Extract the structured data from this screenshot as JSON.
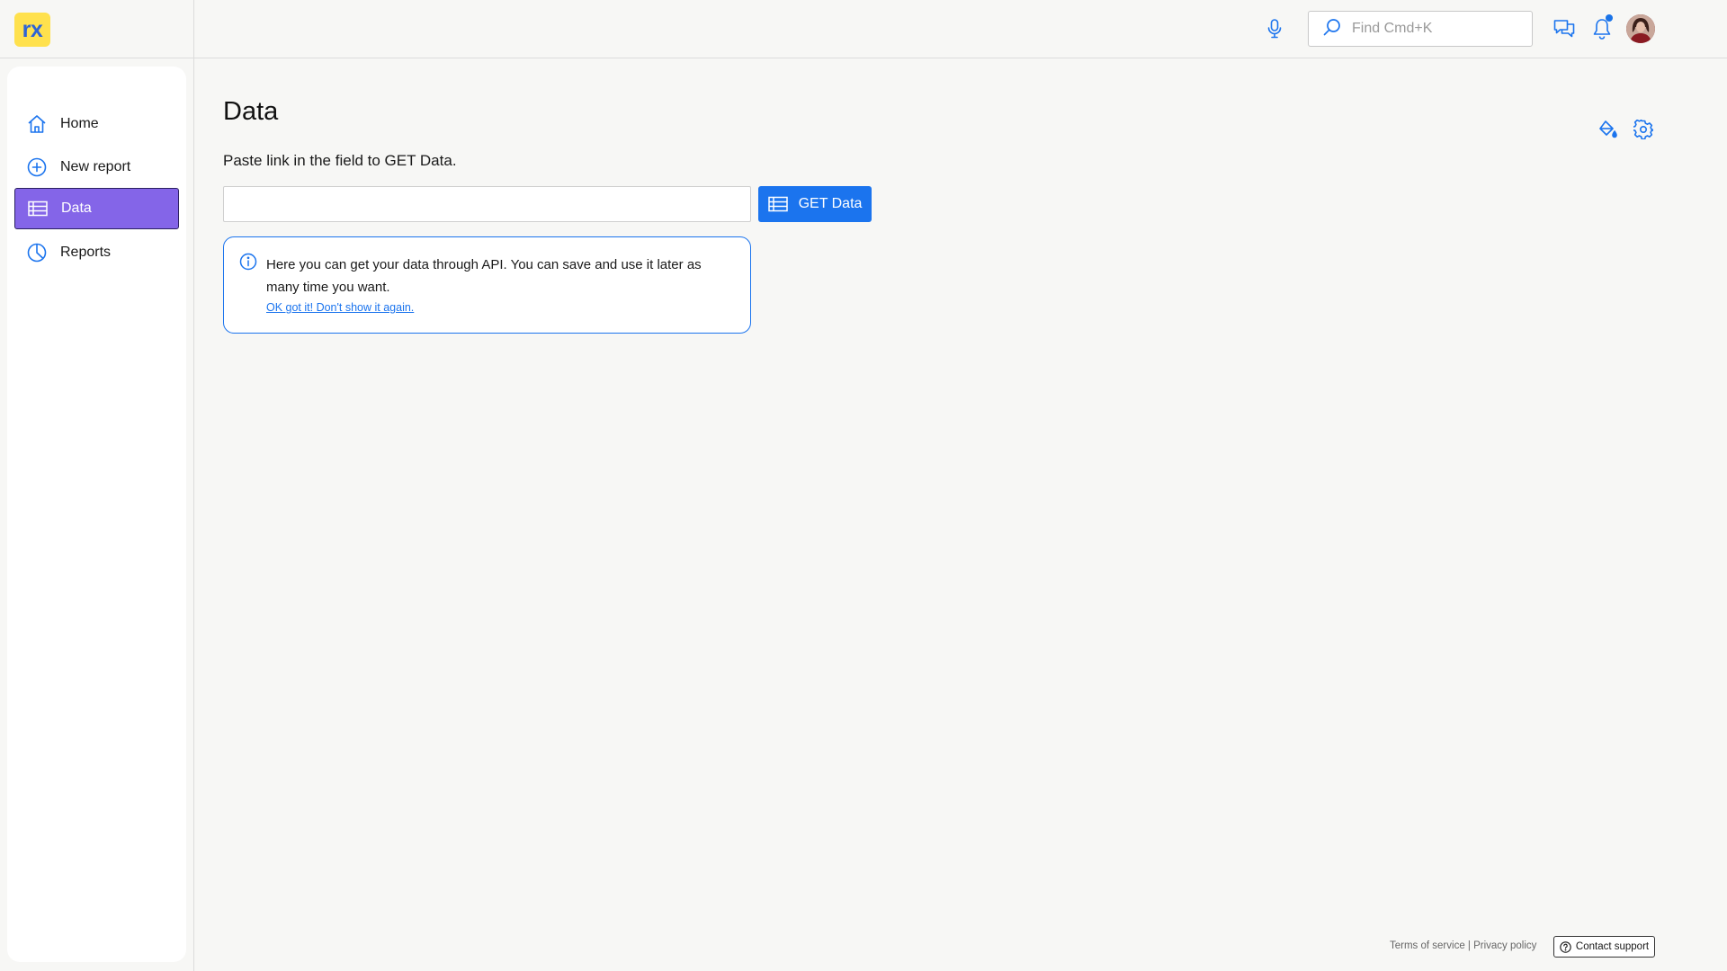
{
  "app": {
    "logo_text": "rx",
    "logo_color": "#ffe14d",
    "accent_color": "#1b74ee",
    "active_nav_color": "#8465e8"
  },
  "header": {
    "search_placeholder": "Find Cmd+K",
    "mic_icon": "microphone-icon",
    "chat_icon": "chat-icon",
    "notifications_icon": "bell-icon",
    "has_unread_notifications": true
  },
  "sidebar": {
    "items": [
      {
        "label": "Home",
        "icon": "home-icon",
        "active": false
      },
      {
        "label": "New report",
        "icon": "plus-circle-icon",
        "active": false
      },
      {
        "label": "Data",
        "icon": "table-icon",
        "active": true
      },
      {
        "label": "Reports",
        "icon": "pie-chart-icon",
        "active": false
      }
    ]
  },
  "main": {
    "title": "Data",
    "subtitle": "Paste link in the field to GET Data.",
    "input_value": "",
    "get_button_label": "GET Data",
    "info": {
      "text": "Here you can get your data through API. You can save and use it later as many time you want.",
      "link": "OK got it! Don't show it again."
    }
  },
  "footer": {
    "terms": "Terms of service",
    "separator": " | ",
    "privacy": "Privacy policy",
    "contact": "Contact support"
  }
}
